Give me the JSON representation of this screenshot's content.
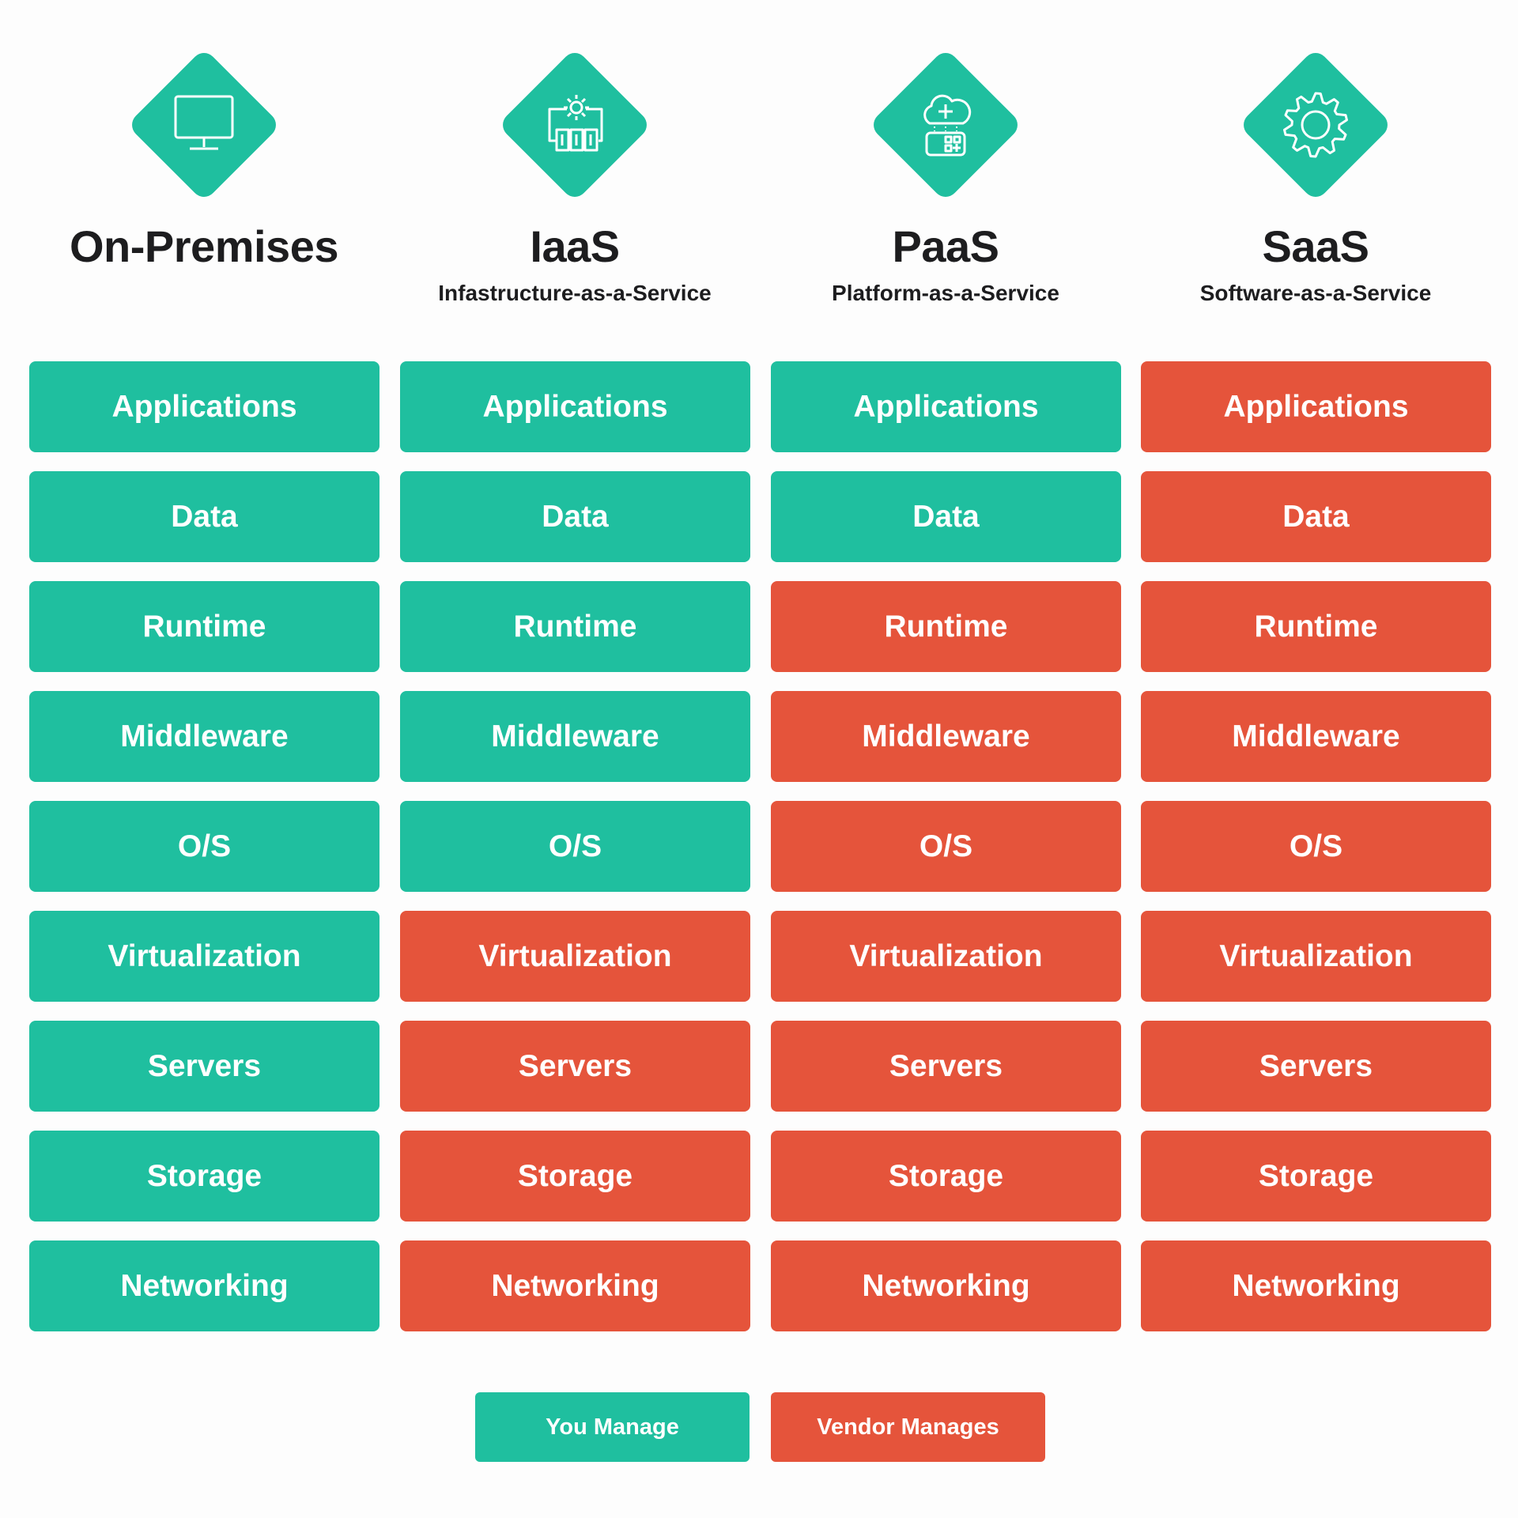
{
  "colors": {
    "you_manage": "#1fbf9f",
    "vendor_manages": "#e5543b",
    "title_text": "#1d1d1f"
  },
  "columns": [
    {
      "title": "On-Premises",
      "subtitle": "",
      "icon": "monitor-icon",
      "layers": [
        {
          "label": "Applications",
          "managed_by": "you"
        },
        {
          "label": "Data",
          "managed_by": "you"
        },
        {
          "label": "Runtime",
          "managed_by": "you"
        },
        {
          "label": "Middleware",
          "managed_by": "you"
        },
        {
          "label": "O/S",
          "managed_by": "you"
        },
        {
          "label": "Virtualization",
          "managed_by": "you"
        },
        {
          "label": "Servers",
          "managed_by": "you"
        },
        {
          "label": "Storage",
          "managed_by": "you"
        },
        {
          "label": "Networking",
          "managed_by": "you"
        }
      ]
    },
    {
      "title": "IaaS",
      "subtitle": "Infastructure-as-a-Service",
      "icon": "gear-servers-icon",
      "layers": [
        {
          "label": "Applications",
          "managed_by": "you"
        },
        {
          "label": "Data",
          "managed_by": "you"
        },
        {
          "label": "Runtime",
          "managed_by": "you"
        },
        {
          "label": "Middleware",
          "managed_by": "you"
        },
        {
          "label": "O/S",
          "managed_by": "you"
        },
        {
          "label": "Virtualization",
          "managed_by": "vendor"
        },
        {
          "label": "Servers",
          "managed_by": "vendor"
        },
        {
          "label": "Storage",
          "managed_by": "vendor"
        },
        {
          "label": "Networking",
          "managed_by": "vendor"
        }
      ]
    },
    {
      "title": "PaaS",
      "subtitle": "Platform-as-a-Service",
      "icon": "cloud-platform-icon",
      "layers": [
        {
          "label": "Applications",
          "managed_by": "you"
        },
        {
          "label": "Data",
          "managed_by": "you"
        },
        {
          "label": "Runtime",
          "managed_by": "vendor"
        },
        {
          "label": "Middleware",
          "managed_by": "vendor"
        },
        {
          "label": "O/S",
          "managed_by": "vendor"
        },
        {
          "label": "Virtualization",
          "managed_by": "vendor"
        },
        {
          "label": "Servers",
          "managed_by": "vendor"
        },
        {
          "label": "Storage",
          "managed_by": "vendor"
        },
        {
          "label": "Networking",
          "managed_by": "vendor"
        }
      ]
    },
    {
      "title": "SaaS",
      "subtitle": "Software-as-a-Service",
      "icon": "gear-icon",
      "layers": [
        {
          "label": "Applications",
          "managed_by": "vendor"
        },
        {
          "label": "Data",
          "managed_by": "vendor"
        },
        {
          "label": "Runtime",
          "managed_by": "vendor"
        },
        {
          "label": "Middleware",
          "managed_by": "vendor"
        },
        {
          "label": "O/S",
          "managed_by": "vendor"
        },
        {
          "label": "Virtualization",
          "managed_by": "vendor"
        },
        {
          "label": "Servers",
          "managed_by": "vendor"
        },
        {
          "label": "Storage",
          "managed_by": "vendor"
        },
        {
          "label": "Networking",
          "managed_by": "vendor"
        }
      ]
    }
  ],
  "legend": {
    "you_manage": "You Manage",
    "vendor_manages": "Vendor Manages"
  }
}
